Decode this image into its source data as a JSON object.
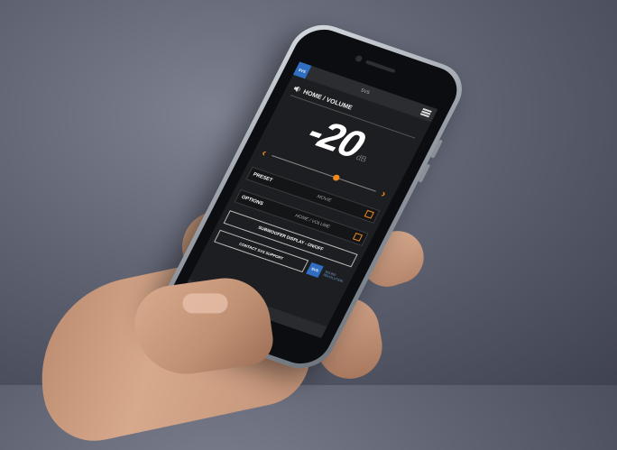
{
  "topbar": {
    "logo": "SVS",
    "title": "SVS"
  },
  "section": {
    "title": "HOME / VOLUME"
  },
  "volume": {
    "value": "-20",
    "unit": "dB",
    "slider_level_percent": 62
  },
  "preset": {
    "label": "PRESET",
    "value": "MOVIE"
  },
  "options": {
    "label": "OPTIONS",
    "value": "HOME / VOLUME"
  },
  "buttons": {
    "subwoofer_display": "SUBWOOFER DISPLAY - ON/OFF",
    "contact_support": "CONTACT SVS SUPPORT"
  },
  "brand": {
    "logo": "SVS",
    "tagline": "SOUND REVOLUTION"
  },
  "icons": {
    "menu": "hamburger-icon",
    "speaker": "speaker-icon",
    "left": "chevron-left-icon",
    "right": "chevron-right-icon",
    "footer": "chevron-up-icon"
  },
  "colors": {
    "accent": "#f08a1c",
    "brand": "#2f6ec1",
    "screen_bg": "#1d1e21"
  }
}
